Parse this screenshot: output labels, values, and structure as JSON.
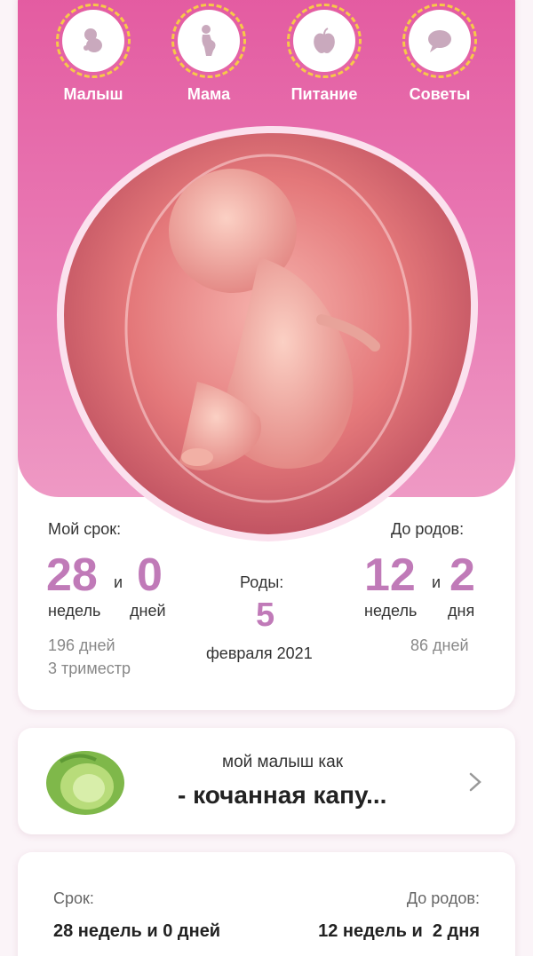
{
  "nav": [
    {
      "label": "Малыш",
      "icon": "baby-icon"
    },
    {
      "label": "Мама",
      "icon": "pregnant-woman-icon"
    },
    {
      "label": "Питание",
      "icon": "apple-icon"
    },
    {
      "label": "Советы",
      "icon": "speech-bubble-icon"
    }
  ],
  "stats": {
    "my_term_label": "Мой срок:",
    "weeks": "28",
    "and1": "и",
    "days": "0",
    "weeks_unit": "недель",
    "days_unit": "дней",
    "total_days": "196 дней",
    "trimester": "3 триместр",
    "birth_label": "Роды:",
    "birth_day": "5",
    "birth_month_year": "февраля 2021",
    "to_birth_label": "До родов:",
    "left_weeks": "12",
    "and2": "и",
    "left_days": "2",
    "left_weeks_unit": "недель",
    "left_days_unit": "дня",
    "left_total_days": "86 дней"
  },
  "baby_size": {
    "caption": "мой малыш как",
    "value": "- кочанная капу...",
    "icon": "cabbage-icon"
  },
  "term_card": {
    "term_label": "Срок:",
    "term_value": "28 недель и 0 дней",
    "to_birth_label": "До родов:",
    "to_birth_value": "12 недель и  2 дня"
  },
  "colors": {
    "pink": "#e35aa0",
    "accent_number": "#c07ab8",
    "nav_ring": "#f7c948"
  }
}
